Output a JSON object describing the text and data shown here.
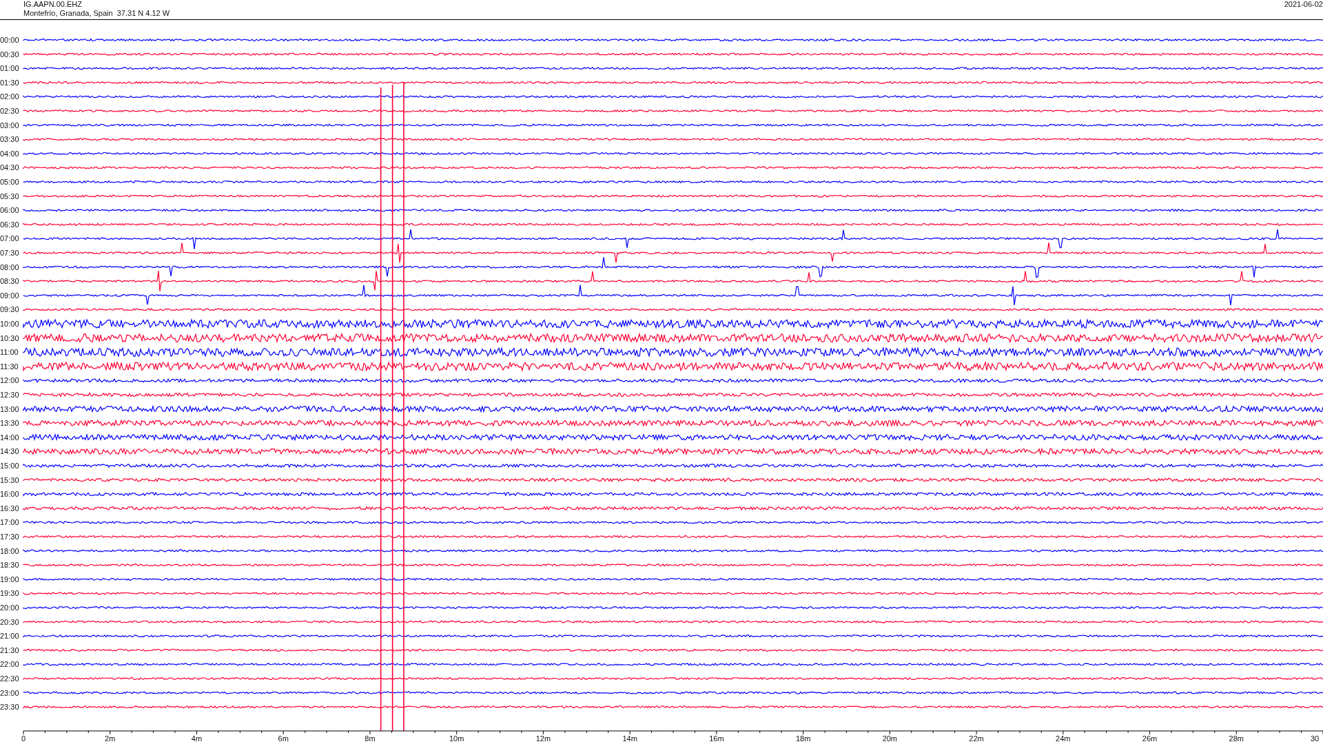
{
  "header": {
    "station": "IG.AAPN.00.EHZ",
    "location": "Montefrío, Granada, Spain  37.31 N 4.12 W",
    "date": "2021-06-02"
  },
  "rows": [
    {
      "label": "00:00",
      "color": "#0000ff"
    },
    {
      "label": "00:30",
      "color": "#ff0033"
    },
    {
      "label": "01:00",
      "color": "#0000ff"
    },
    {
      "label": "01:30",
      "color": "#ff0033"
    },
    {
      "label": "02:00",
      "color": "#0000ff"
    },
    {
      "label": "02:30",
      "color": "#ff0033"
    },
    {
      "label": "03:00",
      "color": "#0000ff"
    },
    {
      "label": "03:30",
      "color": "#ff0033"
    },
    {
      "label": "04:00",
      "color": "#0000ff"
    },
    {
      "label": "04:30",
      "color": "#ff0033"
    },
    {
      "label": "05:00",
      "color": "#0000ff"
    },
    {
      "label": "05:30",
      "color": "#ff0033"
    },
    {
      "label": "06:00",
      "color": "#0000ff"
    },
    {
      "label": "06:30",
      "color": "#ff0033"
    },
    {
      "label": "07:00",
      "color": "#0000ff"
    },
    {
      "label": "07:30",
      "color": "#ff0033"
    },
    {
      "label": "08:00",
      "color": "#0000ff"
    },
    {
      "label": "08:30",
      "color": "#ff0033"
    },
    {
      "label": "09:00",
      "color": "#0000ff"
    },
    {
      "label": "09:30",
      "color": "#ff0033"
    },
    {
      "label": "10:00",
      "color": "#0000ff"
    },
    {
      "label": "10:30",
      "color": "#ff0033"
    },
    {
      "label": "11:00",
      "color": "#0000ff"
    },
    {
      "label": "11:30",
      "color": "#ff0033"
    },
    {
      "label": "12:00",
      "color": "#0000ff"
    },
    {
      "label": "12:30",
      "color": "#ff0033"
    },
    {
      "label": "13:00",
      "color": "#0000ff"
    },
    {
      "label": "13:30",
      "color": "#ff0033"
    },
    {
      "label": "14:00",
      "color": "#0000ff"
    },
    {
      "label": "14:30",
      "color": "#ff0033"
    },
    {
      "label": "15:00",
      "color": "#0000ff"
    },
    {
      "label": "15:30",
      "color": "#ff0033"
    },
    {
      "label": "16:00",
      "color": "#0000ff"
    },
    {
      "label": "16:30",
      "color": "#ff0033"
    },
    {
      "label": "17:00",
      "color": "#0000ff"
    },
    {
      "label": "17:30",
      "color": "#ff0033"
    },
    {
      "label": "18:00",
      "color": "#0000ff"
    },
    {
      "label": "18:30",
      "color": "#ff0033"
    },
    {
      "label": "19:00",
      "color": "#0000ff"
    },
    {
      "label": "19:30",
      "color": "#ff0033"
    },
    {
      "label": "20:00",
      "color": "#0000ff"
    },
    {
      "label": "20:30",
      "color": "#ff0033"
    },
    {
      "label": "21:00",
      "color": "#0000ff"
    },
    {
      "label": "21:30",
      "color": "#ff0033"
    },
    {
      "label": "22:00",
      "color": "#0000ff"
    },
    {
      "label": "22:30",
      "color": "#ff0033"
    },
    {
      "label": "23:00",
      "color": "#0000ff"
    },
    {
      "label": "23:30",
      "color": "#ff0033"
    }
  ],
  "x_axis": {
    "tick_labels": [
      "0",
      "2m",
      "4m",
      "6m",
      "8m",
      "10m",
      "12m",
      "14m",
      "16m",
      "18m",
      "20m",
      "22m",
      "24m",
      "26m",
      "28m",
      "30"
    ]
  }
}
